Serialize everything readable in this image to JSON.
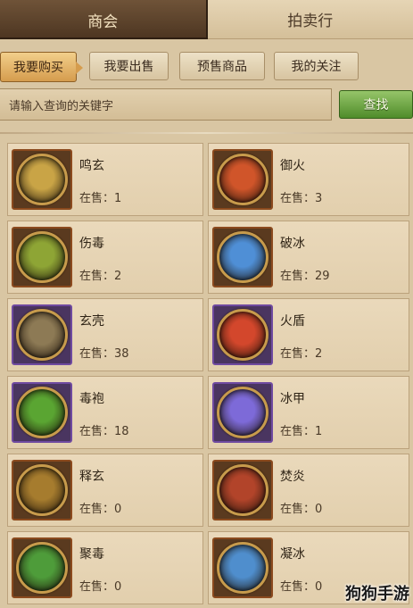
{
  "top_tabs": [
    {
      "label": "商会",
      "active": true
    },
    {
      "label": "拍卖行",
      "active": false
    }
  ],
  "sub_tabs": [
    {
      "label": "我要购买",
      "active": true
    },
    {
      "label": "我要出售",
      "active": false
    },
    {
      "label": "预售商品",
      "active": false
    },
    {
      "label": "我的关注",
      "active": false
    }
  ],
  "search": {
    "placeholder": "请输入查询的关键字",
    "button_label": "查找"
  },
  "count_prefix": "在售：",
  "items": [
    {
      "name": "鸣玄",
      "count": "1",
      "icon": "golden-wing-icon",
      "frame": "orange",
      "color": "#c9a446"
    },
    {
      "name": "御火",
      "count": "3",
      "icon": "fire-swirl-icon",
      "frame": "orange",
      "color": "#d0552a"
    },
    {
      "name": "伤毒",
      "count": "2",
      "icon": "poison-mask-icon",
      "frame": "orange",
      "color": "#8ea535"
    },
    {
      "name": "破冰",
      "count": "29",
      "icon": "ice-shards-icon",
      "frame": "orange",
      "color": "#4f8fd6"
    },
    {
      "name": "玄壳",
      "count": "38",
      "icon": "skull-shell-icon",
      "frame": "purple",
      "color": "#8d7a55"
    },
    {
      "name": "火盾",
      "count": "2",
      "icon": "fire-shield-icon",
      "frame": "purple",
      "color": "#d3472c"
    },
    {
      "name": "毒袍",
      "count": "18",
      "icon": "poison-robe-icon",
      "frame": "purple",
      "color": "#5aa532"
    },
    {
      "name": "冰甲",
      "count": "1",
      "icon": "ice-armor-icon",
      "frame": "purple",
      "color": "#7d6ad8"
    },
    {
      "name": "释玄",
      "count": "0",
      "icon": "dark-figure-icon",
      "frame": "orange",
      "color": "#a67c2e"
    },
    {
      "name": "焚炎",
      "count": "0",
      "icon": "flame-figure-icon",
      "frame": "orange",
      "color": "#b2442a"
    },
    {
      "name": "聚毒",
      "count": "0",
      "icon": "poison-figure-icon",
      "frame": "orange",
      "color": "#4e9c3a"
    },
    {
      "name": "凝冰",
      "count": "0",
      "icon": "frost-figure-icon",
      "frame": "orange",
      "color": "#4f8ecd"
    }
  ],
  "watermark": "狗狗手游"
}
